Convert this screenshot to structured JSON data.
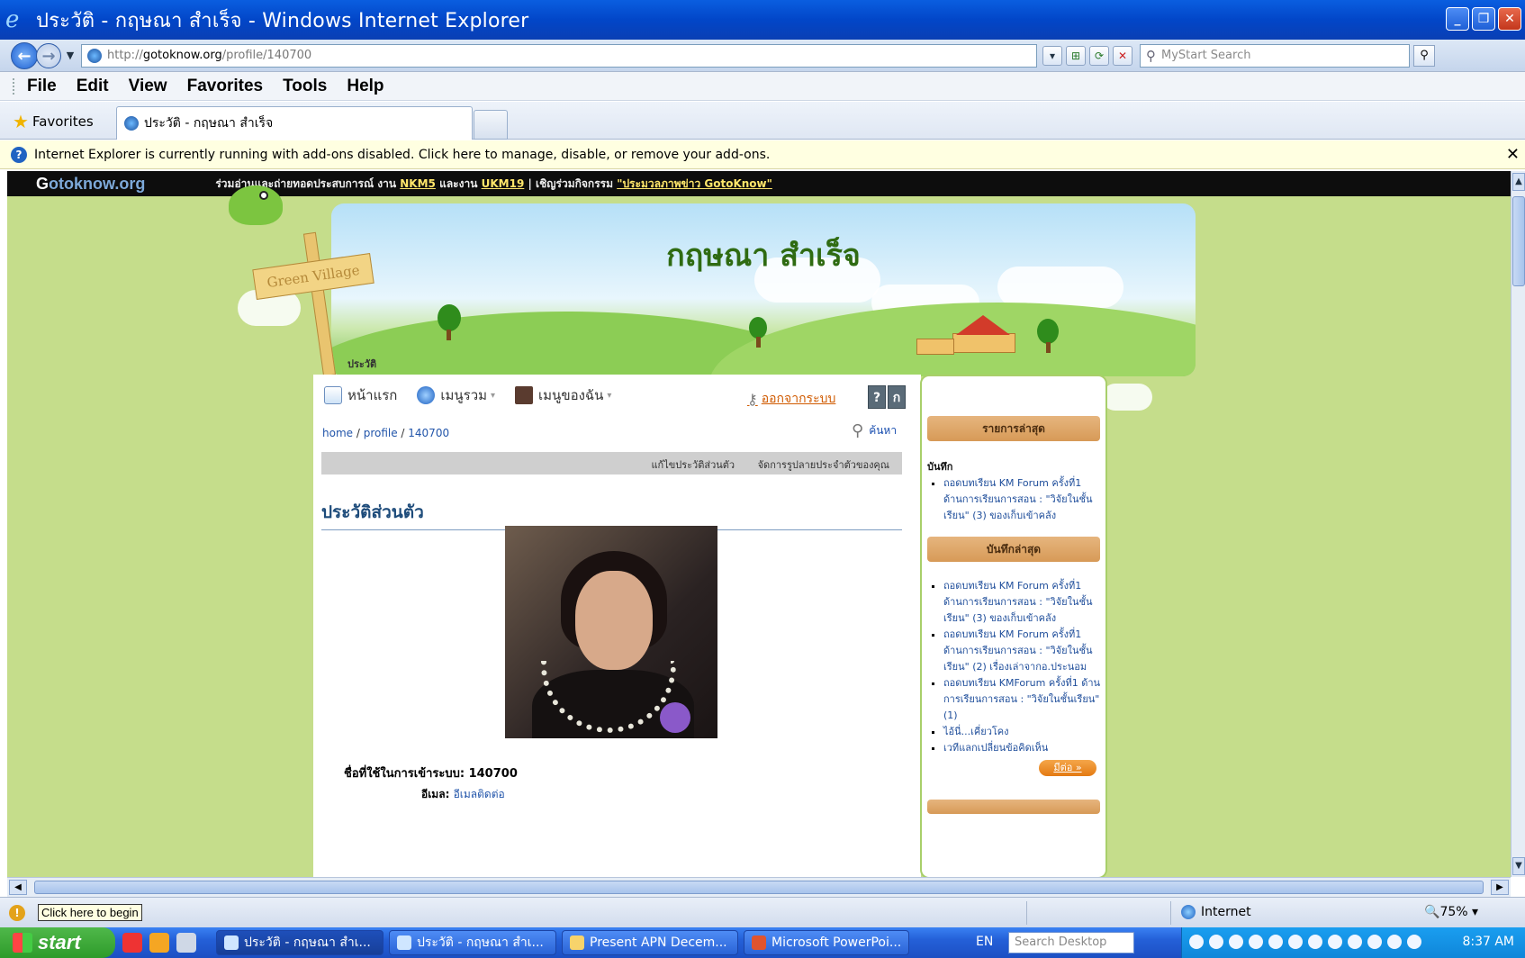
{
  "window": {
    "title": "ประวัติ - กฤษณา สำเร็จ - Windows Internet Explorer"
  },
  "address": {
    "proto": "http://",
    "host": "gotoknow.org",
    "path": "/profile/140700",
    "search_placeholder": "MyStart Search"
  },
  "menu": [
    "File",
    "Edit",
    "View",
    "Favorites",
    "Tools",
    "Help"
  ],
  "favorites_label": "Favorites",
  "tab_title": "ประวัติ - กฤษณา สำเร็จ",
  "infobar_text": "Internet Explorer is currently running with add-ons disabled. Click here to manage, disable, or remove your add-ons.",
  "site": {
    "logo_prefix": "G",
    "logo_rest": "otoknow.org",
    "announce_1": "ร่วมอ่านและถ่ายทอดประสบการณ์ งาน",
    "link_nkm": "NKM5",
    "announce_2": "และงาน",
    "link_ukm": "UKM19",
    "announce_3": "| เชิญร่วมกิจกรรม",
    "link_photo": "\"ประมวลภาพข่าว GotoKnow\"",
    "sign_text": "Green Village",
    "owner_name": "กฤษณา สำเร็จ",
    "page_crumb": "ประวัติ"
  },
  "nav": {
    "home": "หน้าแรก",
    "menu_all": "เมนูรวม",
    "menu_mine": "เมนูของฉัน",
    "logout": "ออกจากระบบ"
  },
  "crumbs": {
    "home": "home",
    "profile": "profile",
    "id": "140700",
    "search": "ค้นหา"
  },
  "actions": {
    "edit_profile": "แก้ไขประวัติส่วนตัว",
    "manage_prefs": "จัดการรูปลายประจำตัวของคุณ"
  },
  "profile": {
    "section_title": "ประวัติส่วนตัว",
    "username_label": "ชื่อที่ใช้ในการเข้าระบบ:",
    "username_value": "140700",
    "email_label": "อีเมล:",
    "email_link": "อีเมลติดต่อ"
  },
  "sidebar": {
    "latest_head": "รายการล่าสุด",
    "blog_label": "บันทึก",
    "latest_items": [
      "ถอดบทเรียน KM Forum ครั้งที่1 ด้านการเรียนการสอน : \"วิจัยในชั้นเรียน\" (3) ของเก็บเข้าคลัง"
    ],
    "recent_head": "บันทึกล่าสุด",
    "recent_items": [
      "ถอดบทเรียน KM Forum ครั้งที่1 ด้านการเรียนการสอน : \"วิจัยในชั้นเรียน\" (3) ของเก็บเข้าคลัง",
      "ถอดบทเรียน KM Forum ครั้งที่1 ด้านการเรียนการสอน : \"วิจัยในชั้นเรียน\" (2) เรื่องเล่าจากอ.ประนอม",
      "ถอดบทเรียน KMForum ครั้งที่1 ด้านการเรียนการสอน : \"วิจัยในชั้นเรียน\" (1)",
      "ไอ้นี่...เคี่ยวโคง",
      "เวทีแลกเปลี่ยนข้อคิดเห็น"
    ],
    "more": "มีต่อ »"
  },
  "status": {
    "tooltip": "Click here to begin",
    "zone": "Internet",
    "zoom": "75%"
  },
  "taskbar": {
    "start": "start",
    "items": [
      "ประวัติ - กฤษณา สำเ...",
      "ประวัติ - กฤษณา สำเ...",
      "Present APN Decem...",
      "Microsoft PowerPoi..."
    ],
    "lang": "EN",
    "search_placeholder": "Search Desktop",
    "clock": "8:37 AM"
  }
}
